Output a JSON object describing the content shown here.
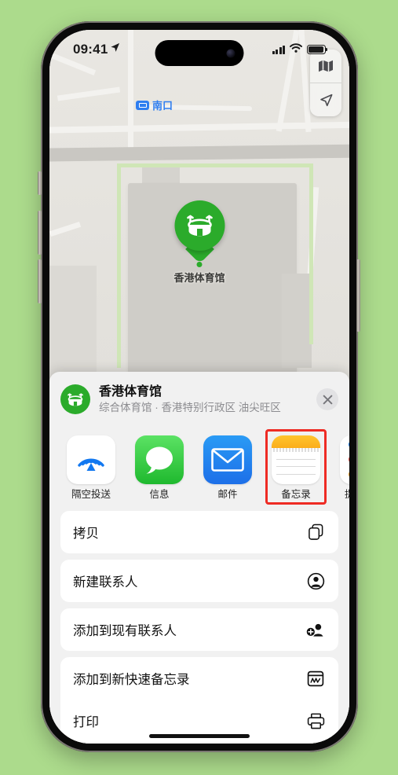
{
  "status_bar": {
    "time": "09:41",
    "location_arrow_icon": "location-arrow-icon",
    "cellular_icon": "signal-bars-icon",
    "wifi_icon": "wifi-icon",
    "battery_icon": "battery-full-icon"
  },
  "map": {
    "transit_label": "南口",
    "transit_badge_icon": "transit-entrance-icon",
    "transit_label_color": "#2f7ef0",
    "pin": {
      "label": "香港体育馆",
      "icon": "stadium-icon",
      "color": "#2bab2b"
    },
    "controls": [
      {
        "name": "map-style-button",
        "icon": "map-icon"
      },
      {
        "name": "locate-me-button",
        "icon": "navigation-arrow-icon"
      }
    ]
  },
  "share_sheet": {
    "place": {
      "title": "香港体育馆",
      "subtitle": "综合体育馆 · 香港特别行政区 油尖旺区",
      "avatar_icon": "stadium-icon",
      "avatar_color": "#2bab2b"
    },
    "close_label": "✕",
    "apps": [
      {
        "label": "隔空投送",
        "icon": "airdrop-icon",
        "selected": false
      },
      {
        "label": "信息",
        "icon": "messages-icon",
        "selected": false
      },
      {
        "label": "邮件",
        "icon": "mail-icon",
        "selected": false
      },
      {
        "label": "备忘录",
        "icon": "notes-icon",
        "selected": true
      },
      {
        "label": "提醒事项",
        "icon": "reminders-icon",
        "selected": false
      }
    ],
    "highlight_color": "#ee2b24",
    "actions": [
      {
        "label": "拷贝",
        "icon": "copy-icon"
      },
      {
        "label": "新建联系人",
        "icon": "person-circle-icon"
      },
      {
        "label": "添加到现有联系人",
        "icon": "person-add-icon"
      },
      {
        "label": "添加到新快速备忘录",
        "icon": "quick-note-icon"
      },
      {
        "label": "打印",
        "icon": "printer-icon"
      }
    ]
  },
  "background_color": "#ACDB8C"
}
